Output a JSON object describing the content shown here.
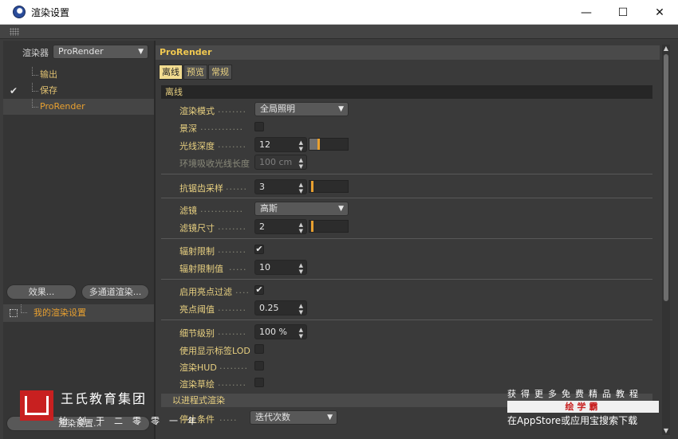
{
  "window": {
    "title": "渲染设置"
  },
  "left": {
    "renderer_label": "渲染器",
    "renderer_value": "ProRender",
    "tree": [
      {
        "label": "输出",
        "checked": false
      },
      {
        "label": "保存",
        "checked": true
      },
      {
        "label": "ProRender",
        "checked": false
      }
    ],
    "effects_button": "效果...",
    "multipass_button": "多通道渲染...",
    "preset_label": "我的渲染设置",
    "bottom_button": "渲染设置..."
  },
  "right": {
    "header": "ProRender",
    "tabs": [
      "离线",
      "预览",
      "常规"
    ],
    "section_offline": "离线",
    "render_mode_label": "渲染模式",
    "render_mode_value": "全局照明",
    "dof_label": "景深",
    "ray_depth_label": "光线深度",
    "ray_depth_value": "12",
    "env_ray_label": "环境吸收光线长度",
    "env_ray_value": "100 cm",
    "aa_label": "抗锯齿采样",
    "aa_value": "3",
    "filter_label": "滤镜",
    "filter_value": "高斯",
    "filter_size_label": "滤镜尺寸",
    "filter_size_value": "2",
    "radiance_clamp_label": "辐射限制",
    "radiance_clamp_value_label": "辐射限制值",
    "radiance_clamp_value": "10",
    "firefly_label": "启用亮点过滤",
    "firefly_threshold_label": "亮点阈值",
    "firefly_threshold_value": "0.25",
    "lod_label": "细节级别",
    "lod_value": "100 %",
    "use_display_lod_label": "使用显示标签LOD",
    "render_hud_label": "渲染HUD",
    "render_sketch_label": "渲染草绘",
    "progressive_section": "以进程式渲染",
    "stop_condition_label": "停止条件",
    "stop_condition_value": "迭代次数"
  },
  "watermark": {
    "brand": "王氏教育集团",
    "slogan": "始创于二零零一年",
    "promo_line1": "获得更多免费精品教程",
    "promo_line2": "绘学霸",
    "promo_line3": "在AppStore或应用宝搜索下载"
  },
  "colors": {
    "accent": "#e8a030",
    "label": "#e8d080",
    "panel": "#3a3a3a"
  }
}
